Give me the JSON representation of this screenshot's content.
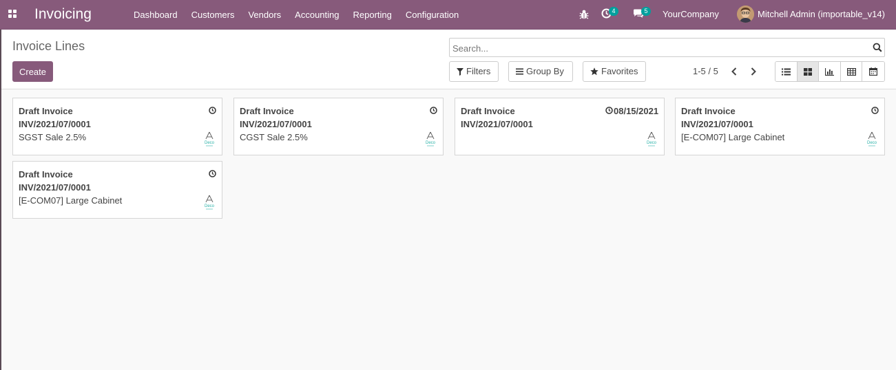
{
  "navbar": {
    "brand": "Invoicing",
    "menu": [
      "Dashboard",
      "Customers",
      "Vendors",
      "Accounting",
      "Reporting",
      "Configuration"
    ],
    "activity_count": "4",
    "message_count": "5",
    "company": "YourCompany",
    "user": "Mitchell Admin (importable_v14)",
    "color": "#875a7b"
  },
  "control_panel": {
    "title": "Invoice Lines",
    "create_label": "Create",
    "search_placeholder": "Search...",
    "filters_label": "Filters",
    "group_by_label": "Group By",
    "favorites_label": "Favorites",
    "pager": "1-5 / 5",
    "views": [
      "list-view-icon",
      "kanban-view-icon",
      "graph-view-icon",
      "pivot-view-icon",
      "calendar-view-icon"
    ],
    "active_view": "kanban"
  },
  "cards": [
    {
      "status": "Draft Invoice",
      "number": "INV/2021/07/0001",
      "product": "SGST Sale 2.5%",
      "date": ""
    },
    {
      "status": "Draft Invoice",
      "number": "INV/2021/07/0001",
      "product": "CGST Sale 2.5%",
      "date": ""
    },
    {
      "status": "Draft Invoice",
      "number": "INV/2021/07/0001",
      "product": "",
      "date": "08/15/2021"
    },
    {
      "status": "Draft Invoice",
      "number": "INV/2021/07/0001",
      "product": "[E-COM07] Large Cabinet",
      "date": ""
    },
    {
      "status": "Draft Invoice",
      "number": "INV/2021/07/0001",
      "product": "[E-COM07] Large Cabinet",
      "date": ""
    }
  ],
  "logo_text": "Deco"
}
